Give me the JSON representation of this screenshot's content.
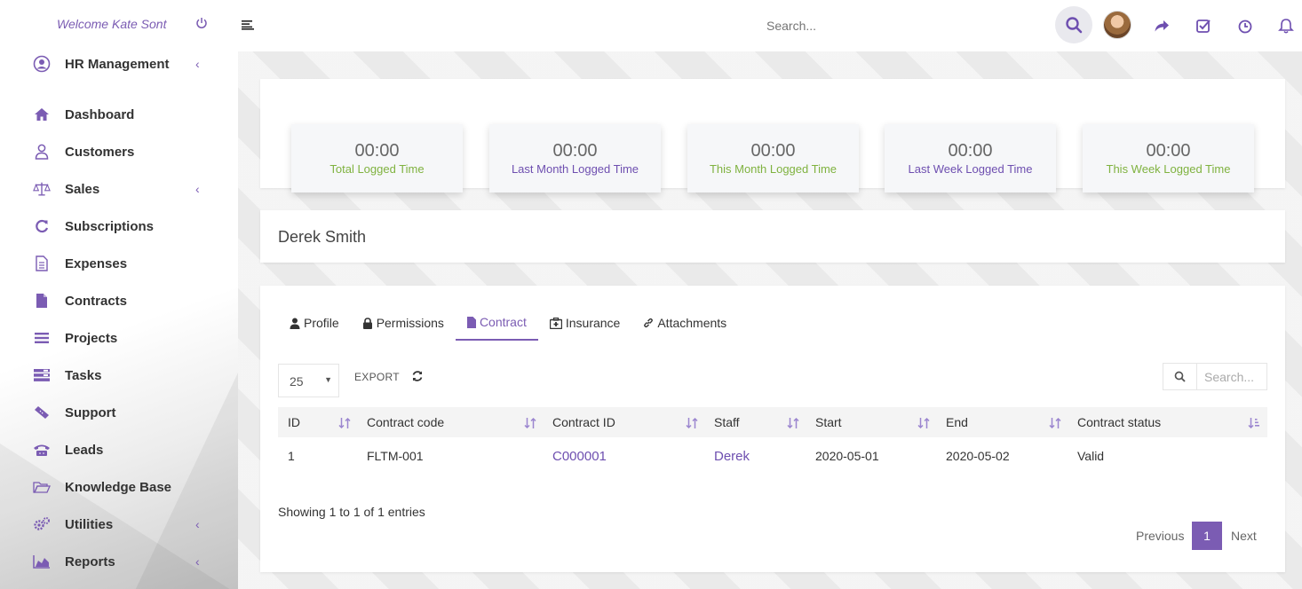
{
  "sidebar": {
    "welcome": "Welcome Kate Sont",
    "module": "HR Management",
    "items": [
      {
        "label": "Dashboard"
      },
      {
        "label": "Customers"
      },
      {
        "label": "Sales"
      },
      {
        "label": "Subscriptions"
      },
      {
        "label": "Expenses"
      },
      {
        "label": "Contracts"
      },
      {
        "label": "Projects"
      },
      {
        "label": "Tasks"
      },
      {
        "label": "Support"
      },
      {
        "label": "Leads"
      },
      {
        "label": "Knowledge Base"
      },
      {
        "label": "Utilities"
      },
      {
        "label": "Reports"
      }
    ]
  },
  "topbar": {
    "search_placeholder": "Search...",
    "icons": [
      "menu-icon",
      "search-icon",
      "share-icon",
      "task-check-icon",
      "clock-icon",
      "bell-icon"
    ]
  },
  "stats": [
    {
      "time": "00:00",
      "label": "Total Logged Time"
    },
    {
      "time": "00:00",
      "label": "Last Month Logged Time"
    },
    {
      "time": "00:00",
      "label": "This Month Logged Time"
    },
    {
      "time": "00:00",
      "label": "Last Week Logged Time"
    },
    {
      "time": "00:00",
      "label": "This Week Logged Time"
    }
  ],
  "staff_name": "Derek Smith",
  "tabs": [
    {
      "label": "Profile"
    },
    {
      "label": "Permissions"
    },
    {
      "label": "Contract"
    },
    {
      "label": "Insurance"
    },
    {
      "label": "Attachments"
    }
  ],
  "table": {
    "page_size": "25",
    "export_label": "EXPORT",
    "search_placeholder": "Search...",
    "columns": [
      "ID",
      "Contract code",
      "Contract ID",
      "Staff",
      "Start",
      "End",
      "Contract status"
    ],
    "rows": [
      [
        "1",
        "FLTM-001",
        "C000001",
        "Derek",
        "2020-05-01",
        "2020-05-02",
        "Valid"
      ]
    ],
    "info": "Showing 1 to 1 of 1 entries",
    "pagination": {
      "previous": "Previous",
      "current": "1",
      "next": "Next"
    }
  },
  "colors": {
    "accent": "#7b5cb3",
    "green": "#7fb23f"
  }
}
